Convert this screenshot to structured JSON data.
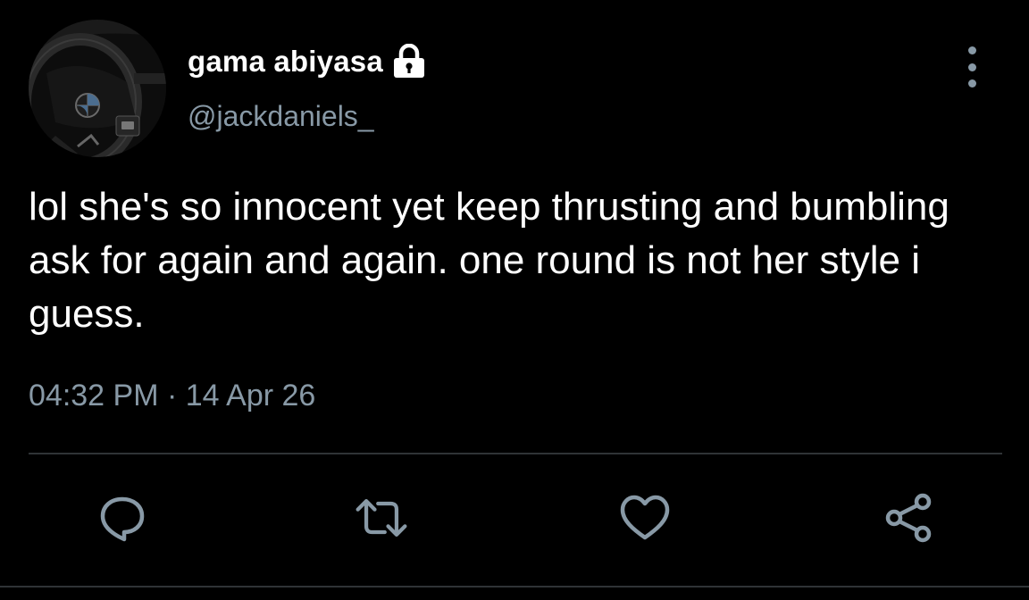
{
  "author": {
    "display_name": "gama abiyasa",
    "handle": "@jackdaniels_",
    "protected": true
  },
  "tweet": {
    "text": "lol she's so innocent yet keep thrusting and bumbling ask for again and again. one round is not her style i guess.",
    "time": "04:32 PM",
    "separator": "·",
    "date": "14 Apr 26"
  },
  "icons": {
    "avatar": "avatar-steering-wheel",
    "lock": "lock-icon",
    "more": "more-vertical-icon",
    "reply": "reply-icon",
    "retweet": "retweet-icon",
    "like": "heart-icon",
    "share": "share-icon"
  },
  "colors": {
    "background": "#000000",
    "primary_text": "#ffffff",
    "secondary_text": "#8899a6",
    "divider": "#2f3336"
  }
}
